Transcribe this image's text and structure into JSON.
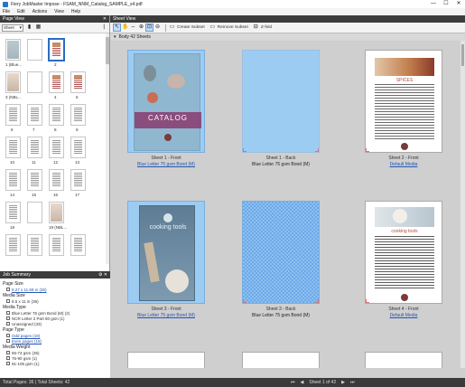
{
  "window": {
    "title": "Fiery JobMaster Impose - FSAM_NNM_Catalog_SAMPLE_s4.pdf",
    "controls": [
      "—",
      "☐",
      "✕"
    ]
  },
  "menu": [
    "File",
    "Edit",
    "Actions",
    "View",
    "Help"
  ],
  "page_view": {
    "title": "Page View",
    "close": "✕",
    "mode": "Sheet",
    "thumb_labels": [
      "1 (Blue...",
      "",
      "2",
      "3 (NBL...",
      "4",
      "5",
      "6",
      "7",
      "8",
      "9",
      "10",
      "11",
      "12",
      "13",
      "14",
      "15",
      "16",
      "17",
      "18",
      "19 (NBL...",
      "20"
    ]
  },
  "job_summary": {
    "title": "Job Summary",
    "sections": [
      {
        "label": "Page Size",
        "items": [
          {
            "text": "8.27 x 11.69 in (36)",
            "link": true
          }
        ]
      },
      {
        "label": "Media Size",
        "items": [
          {
            "text": "8.5 x 11 in (36)",
            "link": false
          }
        ]
      },
      {
        "label": "Media Type",
        "items": [
          {
            "text": "Blue Letter 75 gsm Bond (M) (2)",
            "link": false
          },
          {
            "text": "NCR Letter 2 Part 60 gsm (1)",
            "link": false
          },
          {
            "text": "Unassigned (33)",
            "link": false
          }
        ]
      },
      {
        "label": "Page Type",
        "items": [
          {
            "text": "Odd pages (18)",
            "link": true
          },
          {
            "text": "Even pages (18)",
            "link": true
          }
        ]
      },
      {
        "label": "Media Weight",
        "items": [
          {
            "text": "56-74 gsm (35)",
            "link": false
          },
          {
            "text": "75-90 gsm (1)",
            "link": false
          },
          {
            "text": "91-105 gsm (1)",
            "link": false
          }
        ]
      }
    ]
  },
  "sheet_view": {
    "title": "Sheet View",
    "toolbar": {
      "create_subset": "Create Subset",
      "remove_subset": "Remove Subset",
      "z_fold": "Z-fold"
    },
    "body_header": "Body  42 Sheets",
    "sheets": [
      {
        "caption": "Sheet 1 - Front",
        "media": "Blue Letter 75 gsm Bond (M)",
        "media_link": true,
        "kind": "catalog-cover",
        "cover_title": "CATALOG"
      },
      {
        "caption": "Sheet 1 - Back",
        "media": "Blue Letter 75 gsm Bond (M)",
        "media_link": false,
        "kind": "blank"
      },
      {
        "caption": "Sheet 2 - Front",
        "media": "Default Media",
        "media_link": true,
        "kind": "spices"
      },
      {
        "caption": "Sheet 3 - Front",
        "media": "Blue Letter 75 gsm Bond (M)",
        "media_link": true,
        "kind": "tools-cover",
        "cover_title": "cooking tools"
      },
      {
        "caption": "Sheet 3 - Back",
        "media": "Blue Letter 75 gsm Bond (M)",
        "media_link": false,
        "kind": "checker"
      },
      {
        "caption": "Sheet 4 - Front",
        "media": "Default Media",
        "media_link": true,
        "kind": "tools-list",
        "cover_title": "cooking tools"
      }
    ],
    "spices_title": "SPICES"
  },
  "status": {
    "total_pages": "Total Pages: 36 | Total Sheets: 42",
    "sheet_of": "Sheet 1 of 42"
  }
}
